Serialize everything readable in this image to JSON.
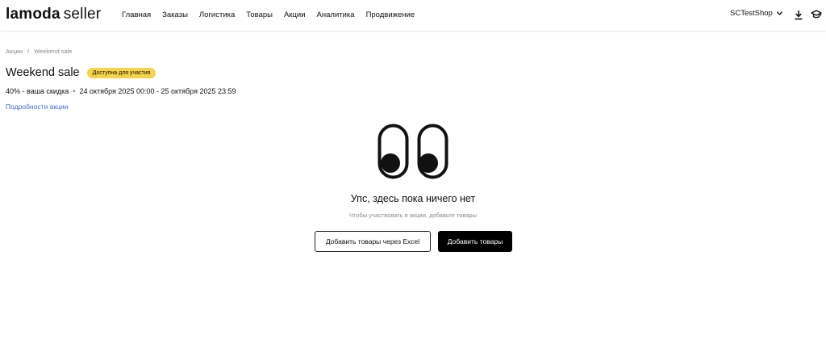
{
  "header": {
    "logo_brand": "lamoda",
    "logo_suffix": "seller",
    "nav": [
      {
        "label": "Главная"
      },
      {
        "label": "Заказы"
      },
      {
        "label": "Логистика"
      },
      {
        "label": "Товары"
      },
      {
        "label": "Акции"
      },
      {
        "label": "Аналитика"
      },
      {
        "label": "Продвижение"
      }
    ],
    "shop_name": "SCTestShop",
    "icons": [
      "chevron-down-icon",
      "download-icon",
      "graduation-cap-icon"
    ]
  },
  "breadcrumb": {
    "items": [
      "Акции",
      "Weekend sale"
    ],
    "separator": "/"
  },
  "promo": {
    "title": "Weekend sale",
    "badge": "Доступна для участия",
    "badge_color": "#f6d34a",
    "discount": "40% - ваша скидка",
    "dates": "24 октября 2025 00:00 - 25 октября 2025 23:59",
    "details_link": "Подробности акции",
    "link_color": "#3a6fd8"
  },
  "empty_state": {
    "illustration": "eyes-icon",
    "title": "Упс, здесь пока ничего нет",
    "subtitle": "Чтобы участвовать в акции, добавьте товары"
  },
  "actions": {
    "excel_button": "Добавить товары через Excel",
    "add_button": "Добавить товары"
  }
}
